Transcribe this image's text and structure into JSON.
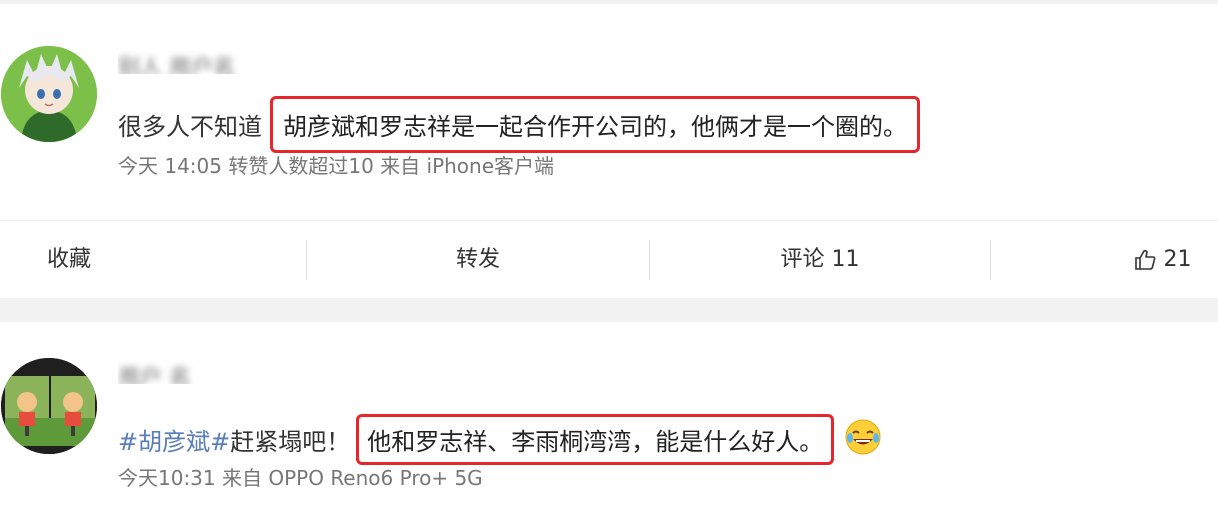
{
  "post1": {
    "content_prefix": "很多人不知道",
    "content_highlight": "胡彦斌和罗志祥是一起合作开公司的，他俩才是一个圈的。",
    "meta": "今天 14:05 转赞人数超过10 来自 iPhone客户端",
    "actions": {
      "collect": "收藏",
      "repost": "转发",
      "comment": "评论 11",
      "like_count": "21"
    }
  },
  "post2": {
    "topic": "#胡彦斌#",
    "content_prefix": "赶紧塌吧！",
    "content_highlight": "他和罗志祥、李雨桐湾湾，能是什么好人。",
    "meta": "今天10:31 来自 OPPO Reno6 Pro+ 5G"
  },
  "icons": {
    "like": "thumbs-up-icon",
    "emoji": "laughing-tears-emoji"
  },
  "colors": {
    "highlight_border": "#e5262b",
    "topic_link": "#5a7db9",
    "meta_text": "#777777"
  }
}
